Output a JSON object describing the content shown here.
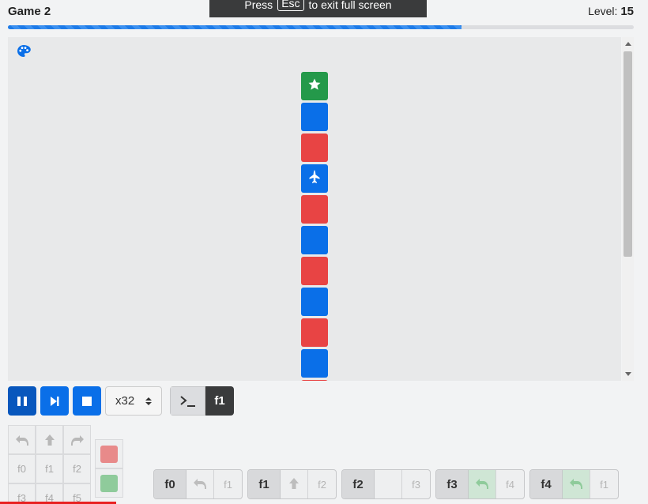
{
  "header": {
    "title": "Game 2",
    "level_label": "Level:",
    "level_value": "15",
    "fullscreen_prefix": "Press",
    "fullscreen_key": "Esc",
    "fullscreen_suffix": "to exit full screen",
    "progress_fraction": 0.725
  },
  "board": {
    "palette_icon": "palette-icon",
    "tiles": [
      {
        "color": "green",
        "icon": "star"
      },
      {
        "color": "blue",
        "icon": ""
      },
      {
        "color": "red",
        "icon": ""
      },
      {
        "color": "blue",
        "icon": "ship"
      },
      {
        "color": "red",
        "icon": ""
      },
      {
        "color": "blue",
        "icon": ""
      },
      {
        "color": "red",
        "icon": ""
      },
      {
        "color": "blue",
        "icon": ""
      },
      {
        "color": "red",
        "icon": ""
      },
      {
        "color": "blue",
        "icon": ""
      },
      {
        "color": "red",
        "icon": ""
      }
    ]
  },
  "controls": {
    "pause_icon": "pause-icon",
    "step_icon": "step-forward-icon",
    "stop_icon": "stop-icon",
    "speed_value": "x32",
    "console_icon": "terminal-icon",
    "current_function": "f1"
  },
  "toolbox": {
    "row1": [
      "turn-left-icon",
      "forward-icon",
      "turn-right-icon"
    ],
    "row2": [
      "f0",
      "f1",
      "f2"
    ],
    "row3": [
      "f3",
      "f4",
      "f5"
    ],
    "colors": [
      "#e88a8a",
      "#8fcb9b"
    ]
  },
  "functions": [
    {
      "name": "f0",
      "slots": [
        {
          "type": "icon",
          "value": "turn-left-icon"
        },
        {
          "type": "text",
          "value": "f1"
        }
      ]
    },
    {
      "name": "f1",
      "slots": [
        {
          "type": "icon",
          "value": "forward-icon"
        },
        {
          "type": "text",
          "value": "f2"
        }
      ]
    },
    {
      "name": "f2",
      "slots": [
        {
          "type": "empty",
          "value": ""
        },
        {
          "type": "text",
          "value": "f3"
        }
      ]
    },
    {
      "name": "f3",
      "slots": [
        {
          "type": "icon-green",
          "value": "turn-left-icon"
        },
        {
          "type": "text",
          "value": "f4"
        }
      ]
    },
    {
      "name": "f4",
      "slots": [
        {
          "type": "icon-green",
          "value": "turn-left-icon"
        },
        {
          "type": "text",
          "value": "f1"
        }
      ]
    }
  ],
  "colors": {
    "blue": "#0a6fe8",
    "red": "#e84444",
    "green": "#24994a",
    "dark": "#3a3b3c"
  }
}
